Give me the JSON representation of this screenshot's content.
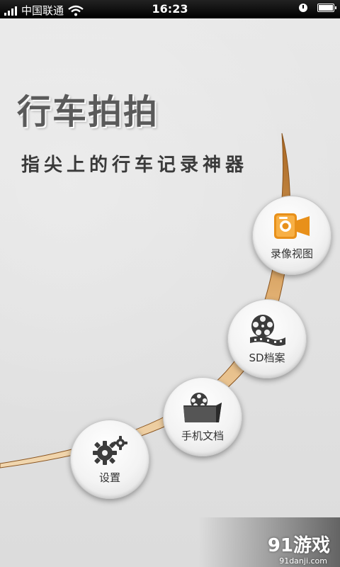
{
  "status_bar": {
    "carrier": "中国联通",
    "time": "16:23",
    "icons": [
      "signal-icon",
      "wifi-icon",
      "clock-icon",
      "battery-icon"
    ]
  },
  "app": {
    "title": "行车拍拍",
    "subtitle": "指尖上的行车记录神器"
  },
  "menu": {
    "record_view": {
      "label": "录像视图",
      "icon": "camcorder-icon"
    },
    "sd_archive": {
      "label": "SD档案",
      "icon": "film-reel-icon"
    },
    "phone_docs": {
      "label": "手机文档",
      "icon": "film-folder-icon"
    },
    "settings": {
      "label": "设置",
      "icon": "gears-icon"
    }
  },
  "watermark": {
    "brand": "91游戏",
    "site": "91danji.com"
  },
  "colors": {
    "accent": "#e8901a",
    "arc": "#c68a3a",
    "icon_dark": "#3c3c3c"
  }
}
